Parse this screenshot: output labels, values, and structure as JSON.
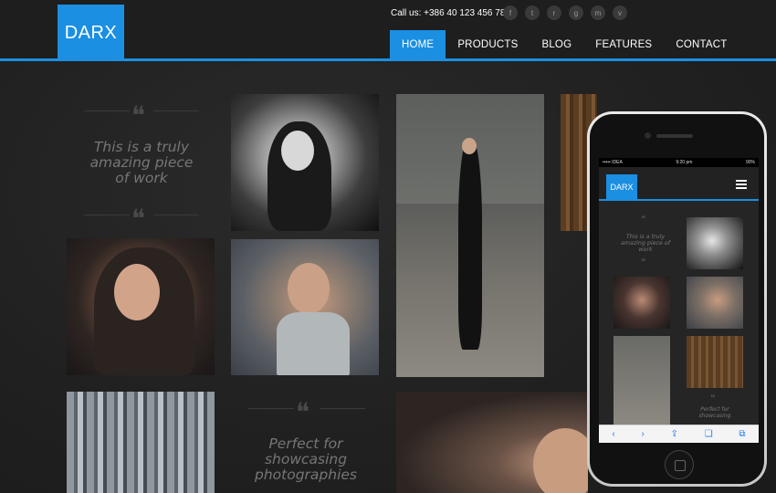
{
  "header": {
    "logo": "DARX",
    "call_us": "Call us: +386 40 123 456 789",
    "socials": [
      "facebook-icon",
      "twitter-icon",
      "rss-icon",
      "google-plus-icon",
      "mail-icon",
      "vine-icon"
    ],
    "social_glyphs": [
      "f",
      "t",
      "r",
      "g",
      "m",
      "v"
    ],
    "nav": [
      "HOME",
      "PRODUCTS",
      "BLOG",
      "FEATURES",
      "CONTACT"
    ],
    "active_nav": "HOME"
  },
  "quotes": {
    "first": [
      "This is a truly",
      "amazing piece",
      "of work"
    ],
    "second": [
      "Perfect for",
      "showcasing",
      "photographies"
    ],
    "mark": "❝"
  },
  "mobile": {
    "status_left": "••••• IDEA",
    "status_center": "9:20 pm",
    "status_right": "90%",
    "logo": "DARX",
    "quote": [
      "This is a truly",
      "amazing piece of",
      "work"
    ],
    "safari_icons": [
      "back-icon",
      "forward-icon",
      "share-icon",
      "bookmarks-icon",
      "tabs-icon"
    ],
    "safari_glyphs": [
      "‹",
      "›",
      "⇪",
      "❏",
      "⧉"
    ]
  },
  "colors": {
    "accent": "#1b8fe2",
    "background": "#232323",
    "quote_text": "#767676"
  }
}
